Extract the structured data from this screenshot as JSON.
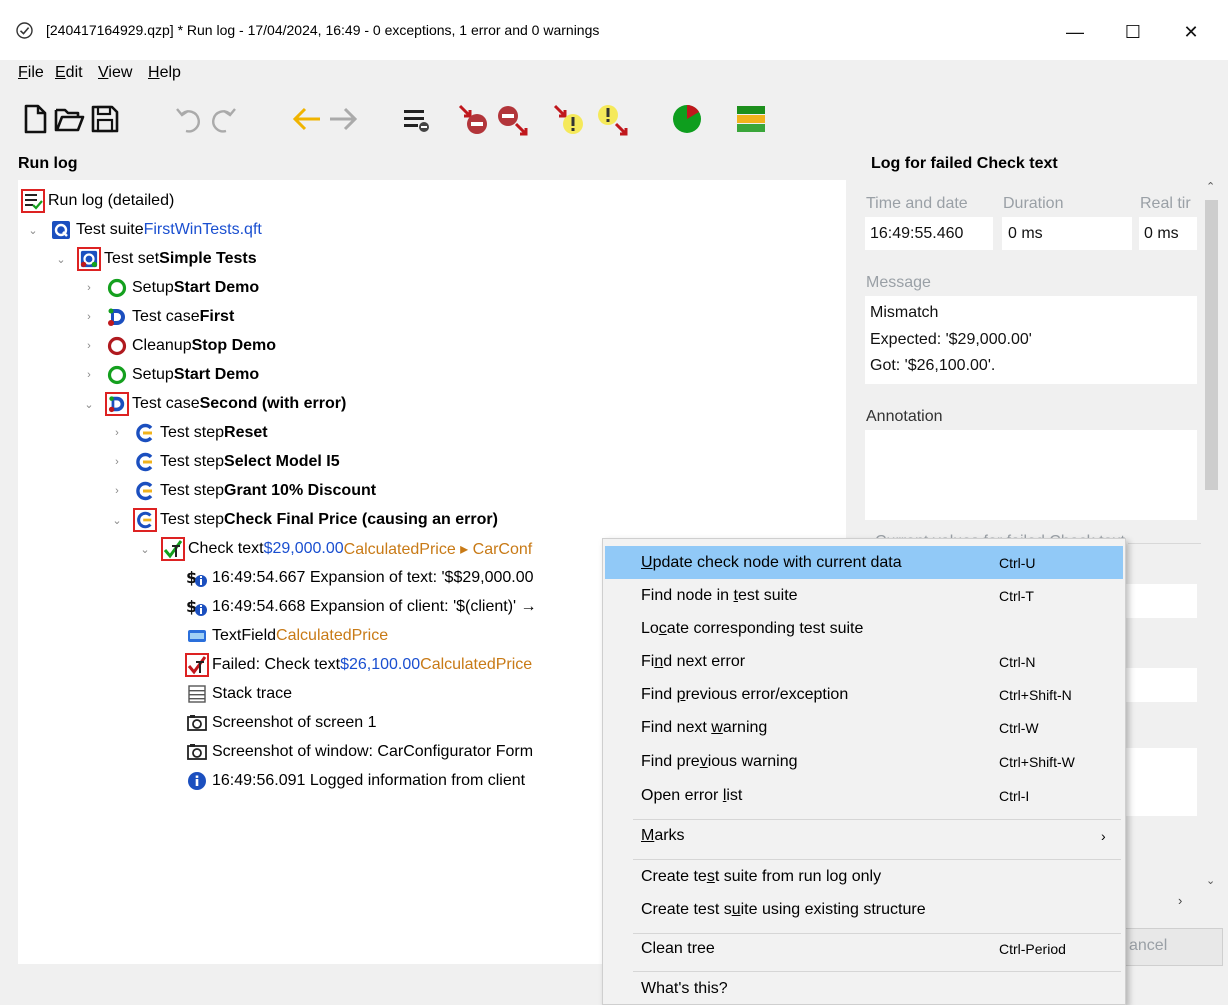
{
  "window": {
    "title": "[240417164929.qzp] * Run log - 17/04/2024, 16:49 - 0 exceptions, 1 error and 0 warnings",
    "minimize": "—",
    "maximize": "☐",
    "close": "✕"
  },
  "menu": [
    {
      "first": "F",
      "rest": "ile"
    },
    {
      "first": "E",
      "rest": "dit"
    },
    {
      "first": "V",
      "rest": "iew"
    },
    {
      "first": "H",
      "rest": "elp"
    }
  ],
  "toolbar_icons": [
    "new-file-icon",
    "open-folder-icon",
    "save-icon",
    "undo-icon",
    "redo-icon",
    "back-arrow-icon",
    "forward-arrow-icon",
    "collapse-list-icon",
    "next-error-icon",
    "previous-error-icon",
    "next-warning-icon",
    "previous-warning-icon",
    "pie-chart-icon",
    "color-bar-icon"
  ],
  "left_panel": {
    "title": "Run log"
  },
  "tree": [
    {
      "pre": "Run log (detailed)",
      "bold": "",
      "blue": "",
      "orange": ""
    },
    {
      "pre": "Test suite ",
      "bold": "",
      "blue": "FirstWinTests.qft",
      "orange": ""
    },
    {
      "pre": "Test set ",
      "bold": "Simple Tests",
      "blue": "",
      "orange": ""
    },
    {
      "pre": "Setup ",
      "bold": "Start Demo",
      "blue": "",
      "orange": ""
    },
    {
      "pre": "Test case ",
      "bold": "First",
      "blue": "",
      "orange": ""
    },
    {
      "pre": "Cleanup ",
      "bold": "Stop Demo",
      "blue": "",
      "orange": ""
    },
    {
      "pre": "Setup ",
      "bold": "Start Demo",
      "blue": "",
      "orange": ""
    },
    {
      "pre": "Test case ",
      "bold": "Second (with error)",
      "blue": "",
      "orange": ""
    },
    {
      "pre": "Test step ",
      "bold": "Reset",
      "blue": "",
      "orange": ""
    },
    {
      "pre": "Test step ",
      "bold": "Select Model I5",
      "blue": "",
      "orange": ""
    },
    {
      "pre": "Test step ",
      "bold": "Grant 10% Discount",
      "blue": "",
      "orange": ""
    },
    {
      "pre": "Test step ",
      "bold": "Check Final Price (causing an error)",
      "blue": "",
      "orange": ""
    },
    {
      "pre": "Check text ",
      "bold": "",
      "blue": "$29,000.00",
      "orange": " CalculatedPrice ▸ CarConf"
    },
    {
      "pre": "16:49:54.667 Expansion of text: '$$29,000.00",
      "bold": "",
      "blue": "",
      "orange": ""
    },
    {
      "pre": "16:49:54.668 Expansion of client: '$(client)' →",
      "bold": "",
      "blue": "",
      "orange": ""
    },
    {
      "pre": "TextField ",
      "bold": "",
      "blue": "",
      "orange": "CalculatedPrice"
    },
    {
      "pre": "Failed: Check text ",
      "bold": "",
      "blue": "$26,100.00",
      "orange": " CalculatedPrice"
    },
    {
      "pre": "Stack trace",
      "bold": "",
      "blue": "",
      "orange": ""
    },
    {
      "pre": "Screenshot of screen 1",
      "bold": "",
      "blue": "",
      "orange": ""
    },
    {
      "pre": "Screenshot of window: CarConfigurator Form",
      "bold": "",
      "blue": "",
      "orange": ""
    },
    {
      "pre": "16:49:56.091 Logged information from client",
      "bold": "",
      "blue": "",
      "orange": ""
    }
  ],
  "right_panel": {
    "title": "Log for failed Check text",
    "time_label": "Time and date",
    "duration_label": "Duration",
    "realtime_label": "Real tir",
    "time_value": "16:49:55.460",
    "duration_value": "0 ms",
    "realtime_value": "0 ms",
    "message_label": "Message",
    "message_lines": [
      "Mismatch",
      "Expected: '$29,000.00'",
      "Got: '$26,100.00'."
    ],
    "annotation_label": "Annotation",
    "current_values_label": "Current values for failed Check text",
    "cancel_fragment": "ancel"
  },
  "context_menu": {
    "update": {
      "label_pre": "",
      "label_ul": "U",
      "label_post": "pdate check node with current data",
      "shortcut": "Ctrl-U"
    },
    "find_node": {
      "label_pre": "Find node in ",
      "label_ul": "t",
      "label_post": "est suite",
      "shortcut": "Ctrl-T"
    },
    "locate": {
      "label_pre": "Lo",
      "label_ul": "c",
      "label_post": "ate corresponding test suite",
      "shortcut": ""
    },
    "next_error": {
      "label_pre": "Fi",
      "label_ul": "n",
      "label_post": "d next error",
      "shortcut": "Ctrl-N"
    },
    "prev_error": {
      "label_pre": "Find ",
      "label_ul": "p",
      "label_post": "revious error/exception",
      "shortcut": "Ctrl+Shift-N"
    },
    "next_warning": {
      "label_pre": "Find next ",
      "label_ul": "w",
      "label_post": "arning",
      "shortcut": "Ctrl-W"
    },
    "prev_warning": {
      "label_pre": "Find pre",
      "label_ul": "v",
      "label_post": "ious warning",
      "shortcut": "Ctrl+Shift-W"
    },
    "error_list": {
      "label_pre": "Open error ",
      "label_ul": "l",
      "label_post": "ist",
      "shortcut": "Ctrl-I"
    },
    "marks": {
      "label_pre": "",
      "label_ul": "M",
      "label_post": "arks",
      "shortcut": "›"
    },
    "create_log": {
      "label_pre": "Create te",
      "label_ul": "s",
      "label_post": "t suite from run log only",
      "shortcut": ""
    },
    "create_existing": {
      "label_pre": "Create test s",
      "label_ul": "u",
      "label_post": "ite using existing structure",
      "shortcut": ""
    },
    "clean_tree": {
      "label_pre": "Clean tree",
      "label_ul": "",
      "label_post": "",
      "shortcut": "Ctrl-Period"
    },
    "whats_this": {
      "label_pre": "What's this?",
      "label_ul": "",
      "label_post": "",
      "shortcut": ""
    }
  },
  "colors": {
    "highlight": "#91c9f7",
    "blue_text": "#1a4fd0",
    "orange_text": "#c87a16",
    "error_box": "#dd2222"
  }
}
